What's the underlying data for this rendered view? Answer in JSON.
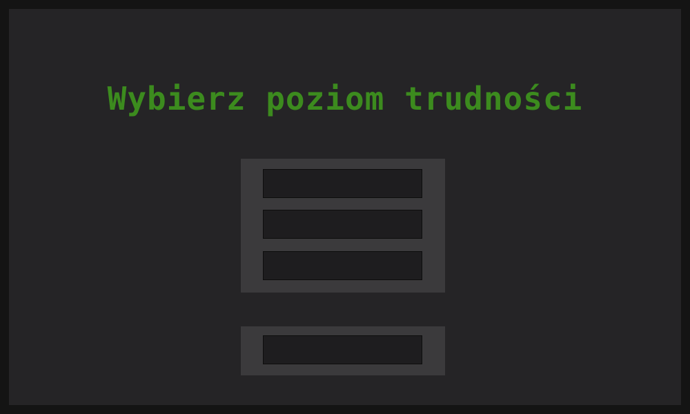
{
  "menu": {
    "title": "Wybierz poziom trudności",
    "difficulty_buttons": [
      {
        "label": ""
      },
      {
        "label": ""
      },
      {
        "label": ""
      }
    ],
    "back_button": {
      "label": ""
    }
  },
  "colors": {
    "frame": "#141414",
    "background": "#252426",
    "title": "#3c8b1e",
    "panel": "#3b3a3c",
    "button": "#1e1d1f"
  }
}
